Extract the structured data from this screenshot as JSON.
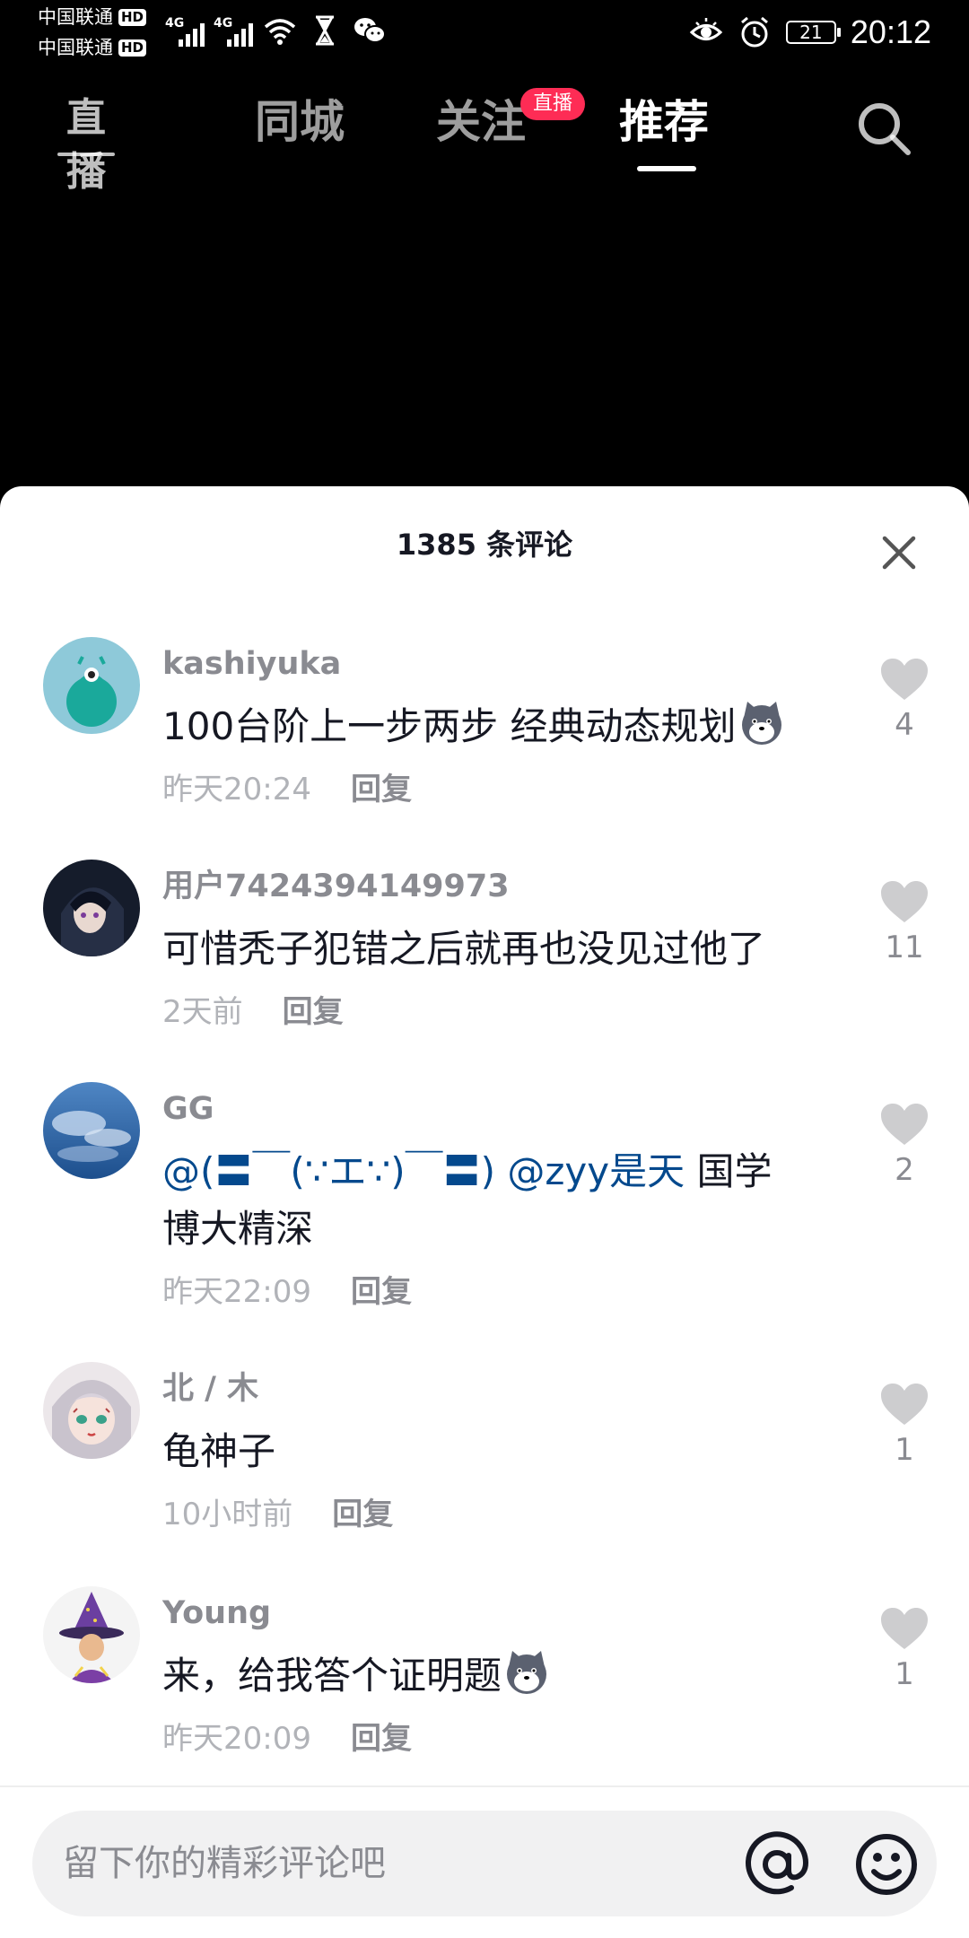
{
  "status_bar": {
    "carrier_1": "中国联通",
    "carrier_2": "中国联通",
    "hd_label": "HD",
    "network_label": "4G",
    "battery_level": "21",
    "time": "20:12"
  },
  "top_nav": {
    "live_label": "直播",
    "tabs": [
      {
        "label": "同城"
      },
      {
        "label": "关注"
      },
      {
        "label": "推荐"
      }
    ],
    "follow_badge": "直播",
    "active_tab": "推荐"
  },
  "comments_sheet": {
    "title": "1385 条评论",
    "reply_label": "回复",
    "comments": [
      {
        "username": "kashiyuka",
        "text": "100台阶上一步两步 经典动态规划",
        "time": "昨天20:24",
        "likes": "4"
      },
      {
        "username": "用户7424394149973",
        "text": "可惜秃子犯错之后就再也没见过他了",
        "time": "2天前",
        "likes": "11"
      },
      {
        "username": "GG",
        "mention_1": "@(〓￣(∵エ∵)￣〓)",
        "mention_2": "@zyy是天",
        "text_line1": "国学",
        "text_line2": "博大精深",
        "time": "昨天22:09",
        "likes": "2"
      },
      {
        "username": "北 / 木",
        "text": "龟神子",
        "time": "10小时前",
        "likes": "1"
      },
      {
        "username": "Young",
        "text": "来，给我答个证明题",
        "time": "昨天20:09",
        "likes": "1"
      }
    ]
  },
  "input_bar": {
    "placeholder": "留下你的精彩评论吧"
  },
  "colors": {
    "accent": "#fe2c55",
    "mention": "#04498d",
    "name_gray": "#8a8b91"
  }
}
